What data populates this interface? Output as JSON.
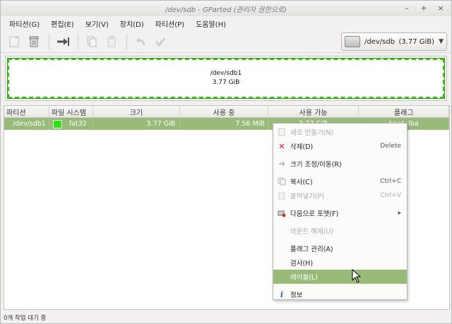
{
  "window": {
    "title": "/dev/sdb - GParted (관리자 권한으로)",
    "controls": [
      "–",
      "+",
      "×"
    ]
  },
  "menubar": [
    "파티션(G)",
    "편집(E)",
    "보기(V)",
    "장치(D)",
    "파티션(P)",
    "도움말(H)"
  ],
  "toolbar": {
    "icons": [
      "new-icon",
      "delete-icon",
      "apply-resize-icon",
      "copy-icon",
      "paste-icon",
      "undo-icon",
      "apply-icon"
    ],
    "device": {
      "name": "/dev/sdb",
      "size": "(3.77 GiB)"
    }
  },
  "disk_map": {
    "partition_name": "/dev/sdb1",
    "partition_size": "3.77 GiB",
    "color": "#39c214"
  },
  "table": {
    "headers": [
      "파티션",
      "파일 시스템",
      "크기",
      "사용 중",
      "사용 가능",
      "플래그"
    ],
    "rows": [
      {
        "partition": "/dev/sdb1",
        "filesystem": "fat32",
        "size": "3.77 GiB",
        "used": "7.56 MiB",
        "unused": "3.77 GiB",
        "flags": "boot, lba"
      }
    ]
  },
  "context_menu": {
    "items": [
      {
        "label": "새로 만들기(N)",
        "accel": "",
        "disabled": true,
        "icon": "new-icon"
      },
      {
        "label": "삭제(D)",
        "accel": "Delete",
        "disabled": false,
        "icon": "delete-x-icon"
      },
      {
        "label": "크기 조정/이동(R)",
        "accel": "",
        "disabled": false,
        "icon": "resize-icon"
      },
      {
        "label": "복사(C)",
        "accel": "Ctrl+C",
        "disabled": false,
        "icon": "copy-icon"
      },
      {
        "label": "붙여넣기(P)",
        "accel": "Ctrl+V",
        "disabled": true,
        "icon": "paste-icon"
      },
      {
        "label": "다음으로 포맷(F)",
        "accel": "▸",
        "disabled": false,
        "icon": "format-icon"
      },
      {
        "label": "마운트 해제(U)",
        "accel": "",
        "disabled": true,
        "icon": ""
      },
      {
        "label": "플래그 관리(A)",
        "accel": "",
        "disabled": false,
        "icon": ""
      },
      {
        "label": "검사(H)",
        "accel": "",
        "disabled": false,
        "icon": ""
      },
      {
        "label": "레이블(L)",
        "accel": "",
        "disabled": false,
        "icon": ""
      },
      {
        "label": "정보",
        "accel": "",
        "disabled": false,
        "icon": "info-icon"
      }
    ]
  },
  "status": "0개 작업 대기 중",
  "colors": {
    "selection": "#99bb7a",
    "fat32": "#2ee20f"
  }
}
